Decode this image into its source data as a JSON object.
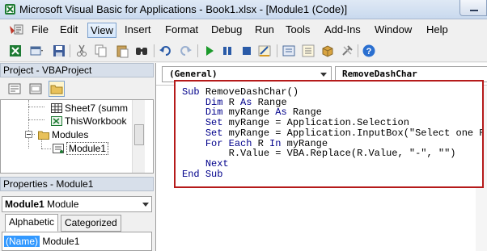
{
  "window": {
    "title": "Microsoft Visual Basic for Applications - Book1.xlsx - [Module1 (Code)]"
  },
  "menu": {
    "items": [
      "File",
      "Edit",
      "View",
      "Insert",
      "Format",
      "Debug",
      "Run",
      "Tools",
      "Add-Ins",
      "Window",
      "Help"
    ],
    "active": "View"
  },
  "toolbar": {
    "icons": [
      "excel-icon",
      "insert-userform-icon",
      "save-icon",
      "cut-icon",
      "copy-icon",
      "paste-icon",
      "find-icon",
      "undo-icon",
      "redo-icon",
      "run-icon",
      "break-icon",
      "reset-icon",
      "design-mode-icon",
      "project-explorer-icon",
      "properties-icon",
      "object-browser-icon",
      "toolbox-icon",
      "help-icon"
    ]
  },
  "project": {
    "header": "Project - VBAProject",
    "tree": [
      {
        "label": "Sheet7 (summ",
        "icon": "sheet-icon"
      },
      {
        "label": "ThisWorkbook",
        "icon": "workbook-icon"
      },
      {
        "label": "Modules",
        "icon": "folder-icon"
      },
      {
        "label": "Module1",
        "icon": "module-icon",
        "selected": true
      }
    ]
  },
  "properties": {
    "header": "Properties - Module1",
    "object_name": "Module1",
    "object_type": "Module",
    "tabs": [
      "Alphabetic",
      "Categorized"
    ],
    "active_tab": "Alphabetic",
    "rows": [
      {
        "name": "(Name)",
        "value": "Module1"
      }
    ]
  },
  "code_pane": {
    "object_combo": "(General)",
    "proc_combo": "RemoveDashChar",
    "lines": [
      "Sub RemoveDashChar()",
      "    Dim R As Range",
      "    Dim myRange As Range",
      "    Set myRange = Application.Selection",
      "    Set myRange = Application.InputBox(\"Select one Range that you want to remove dash\", \"RemoveDashChar\", myRange.Address, Type:=8)",
      "    For Each R In myRange",
      "        R.Value = VBA.Replace(R.Value, \"-\", \"\")",
      "    Next",
      "End Sub"
    ]
  },
  "colors": {
    "highlight_border": "#b51a1a",
    "keyword": "#00008b",
    "selection": "#3399ff"
  }
}
